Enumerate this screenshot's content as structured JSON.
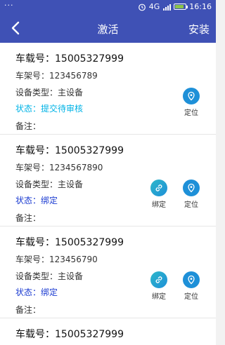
{
  "statusbar": {
    "left": "···",
    "network": "4G",
    "time": "16:16"
  },
  "appbar": {
    "title": "激活",
    "action": "安装"
  },
  "labels": {
    "plate": "车载号：",
    "frame": "车架号：",
    "device_type": "设备类型：",
    "status": "状态：",
    "remark": "备注："
  },
  "buttons": {
    "locate": "定位",
    "bind": "绑定"
  },
  "cards": [
    {
      "plate": "15005327999",
      "frame": "123456789",
      "device_type": "主设备",
      "status": "提交待审核",
      "remark": ""
    },
    {
      "plate": "15005327999",
      "frame": "1234567890",
      "device_type": "主设备",
      "status": "绑定",
      "remark": ""
    },
    {
      "plate": "15005327999",
      "frame": "123456790",
      "device_type": "主设备",
      "status": "绑定",
      "remark": ""
    },
    {
      "plate": "15005327999"
    }
  ],
  "colors": {
    "primary": "#3f51b5",
    "status_pending": "#00b3e6",
    "status_bound": "#1b3bd1",
    "icon_blue": "#1e90d8"
  }
}
